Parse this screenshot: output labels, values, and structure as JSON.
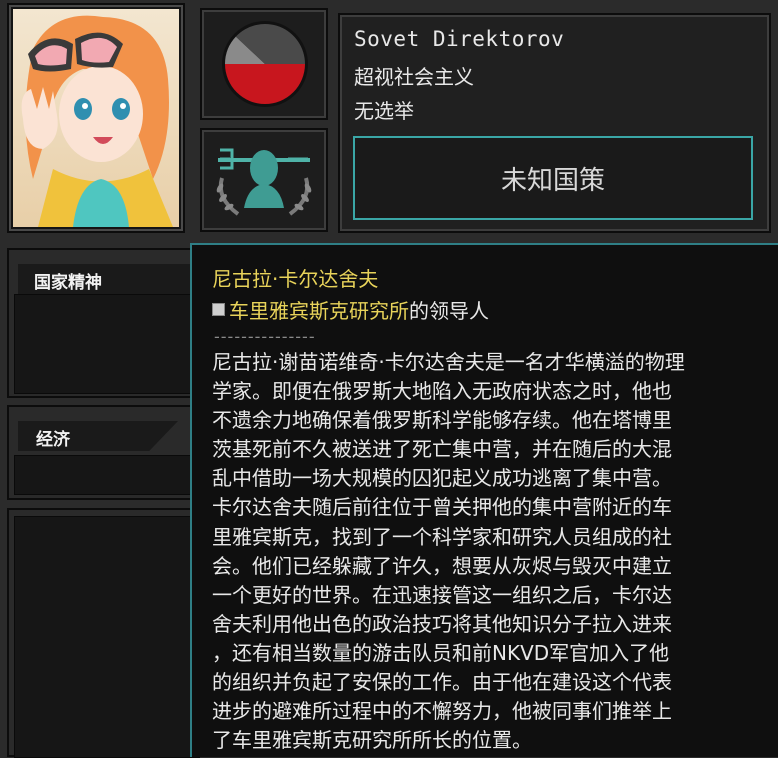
{
  "country": {
    "name": "Sovet Direktorov",
    "ideology": "超视社会主义",
    "election": "无选举",
    "national_focus_button": "未知国策"
  },
  "ideology_pie": {
    "slices": [
      {
        "color": "#c8161e",
        "fraction": 0.5
      },
      {
        "color": "#8a8a8a",
        "fraction": 0.12
      },
      {
        "color": "#4a4a4a",
        "fraction": 0.38
      }
    ]
  },
  "panels": {
    "national_spirit_title": "国家精神",
    "economy_title": "经济"
  },
  "tooltip": {
    "leader_name": "尼古拉·卡尔达舍夫",
    "org_name": "车里雅宾斯克研究所",
    "org_suffix": "的领导人",
    "separator": "---------------",
    "bio_lines": [
      "尼古拉·谢苗诺维奇·卡尔达舍夫是一名才华横溢的物理",
      "学家。即便在俄罗斯大地陷入无政府状态之时，他也",
      "不遗余力地确保着俄罗斯科学能够存续。他在塔博里",
      "茨基死前不久被送进了死亡集中营，并在随后的大混",
      "乱中借助一场大规模的囚犯起义成功逃离了集中营。",
      "卡尔达舍夫随后前往位于曾关押他的集中营附近的车",
      "里雅宾斯克，找到了一个科学家和研究人员组成的社",
      "会。他们已经躲藏了许久，想要从灰烬与毁灭中建立",
      "一个更好的世界。在迅速接管这一组织之后，卡尔达",
      "舍夫利用他出色的政治技巧将其他知识分子拉入进来",
      "，还有相当数量的游击队员和前NKVD军官加入了他",
      "的组织并负起了安保的工作。由于他在建设这个代表",
      "进步的避难所过程中的不懈努力，他被同事们推举上",
      "了车里雅宾斯克研究所所长的位置。"
    ]
  }
}
